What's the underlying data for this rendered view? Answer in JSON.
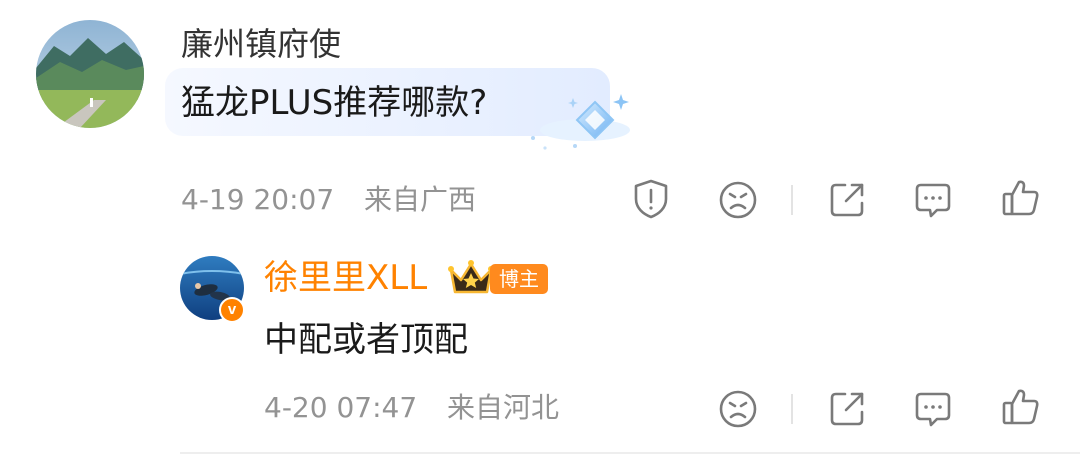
{
  "main_comment": {
    "username": "廉州镇府使",
    "text": "猛龙PLUS推荐哪款?",
    "timestamp": "4-19 20:07",
    "location": "来自广西"
  },
  "reply": {
    "username": "徐里里XLL",
    "badge": "博主",
    "verified_mark": "v",
    "text": "中配或者顶配",
    "timestamp": "4-20 07:47",
    "location": "来自河北"
  },
  "icons": {
    "report": "report-icon",
    "sad_face": "sad-face-icon",
    "share": "share-icon",
    "comment": "comment-icon",
    "like": "like-icon"
  },
  "colors": {
    "username_primary": "#333333",
    "text": "#1a1a1a",
    "meta": "#939393",
    "blogger_name": "#ff8200",
    "icon": "#7a7a7a"
  }
}
